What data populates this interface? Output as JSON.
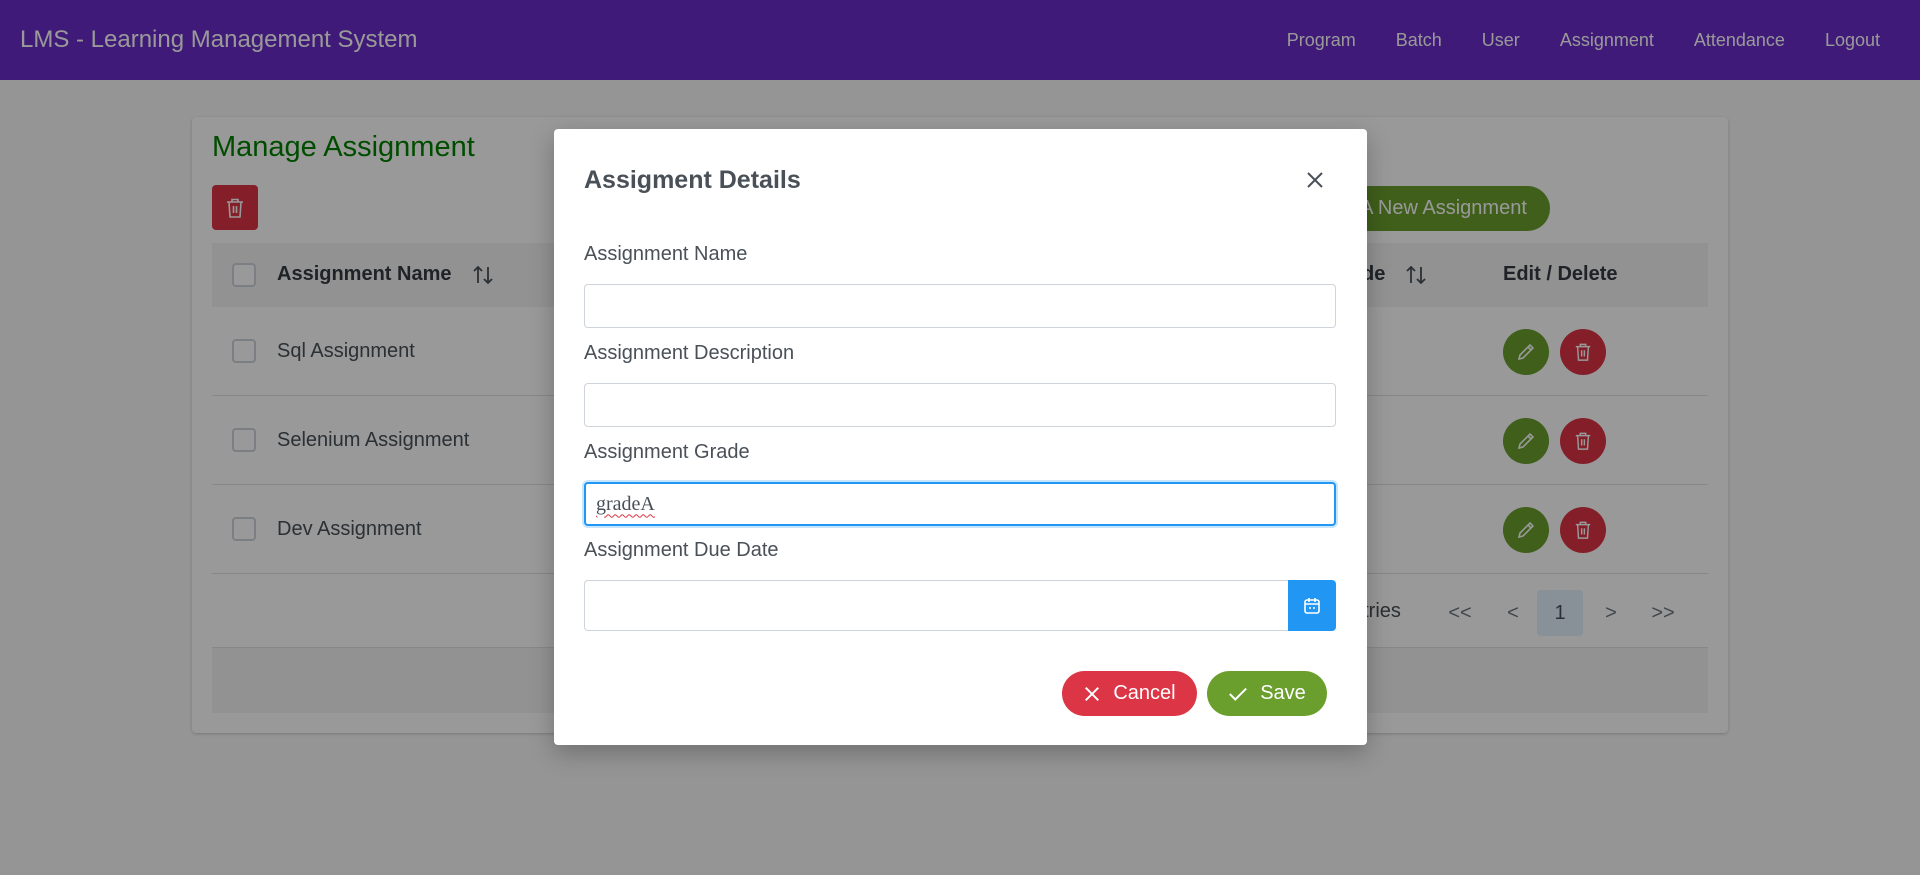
{
  "app": {
    "title": "LMS - Learning Management System",
    "nav": [
      "Program",
      "Batch",
      "User",
      "Assignment",
      "Attendance",
      "Logout"
    ]
  },
  "page": {
    "title": "Manage Assignment",
    "add_button": "A New Assignment"
  },
  "table": {
    "headers": {
      "name": "Assignment Name",
      "grade": "de",
      "actions": "Edit / Delete"
    },
    "rows": [
      {
        "name": "Sql Assignment"
      },
      {
        "name": "Selenium Assignment"
      },
      {
        "name": "Dev Assignment"
      }
    ],
    "paginator": {
      "entries_text": "ntries",
      "first": "<<",
      "prev": "<",
      "page": "1",
      "next": ">",
      "last": ">>"
    }
  },
  "modal": {
    "title": "Assigment Details",
    "fields": {
      "name_label": "Assignment Name",
      "name_value": "",
      "description_label": "Assignment Description",
      "description_value": "",
      "grade_label": "Assignment Grade",
      "grade_value": "gradeA",
      "due_date_label": "Assignment Due Date",
      "due_date_value": ""
    },
    "cancel_label": "Cancel",
    "save_label": "Save"
  },
  "colors": {
    "nav_bg": "#6a2cc8",
    "primary_green": "#6a9f2e",
    "danger_red": "#dc3545",
    "title_green": "#008000",
    "accent_blue": "#2196f3"
  }
}
